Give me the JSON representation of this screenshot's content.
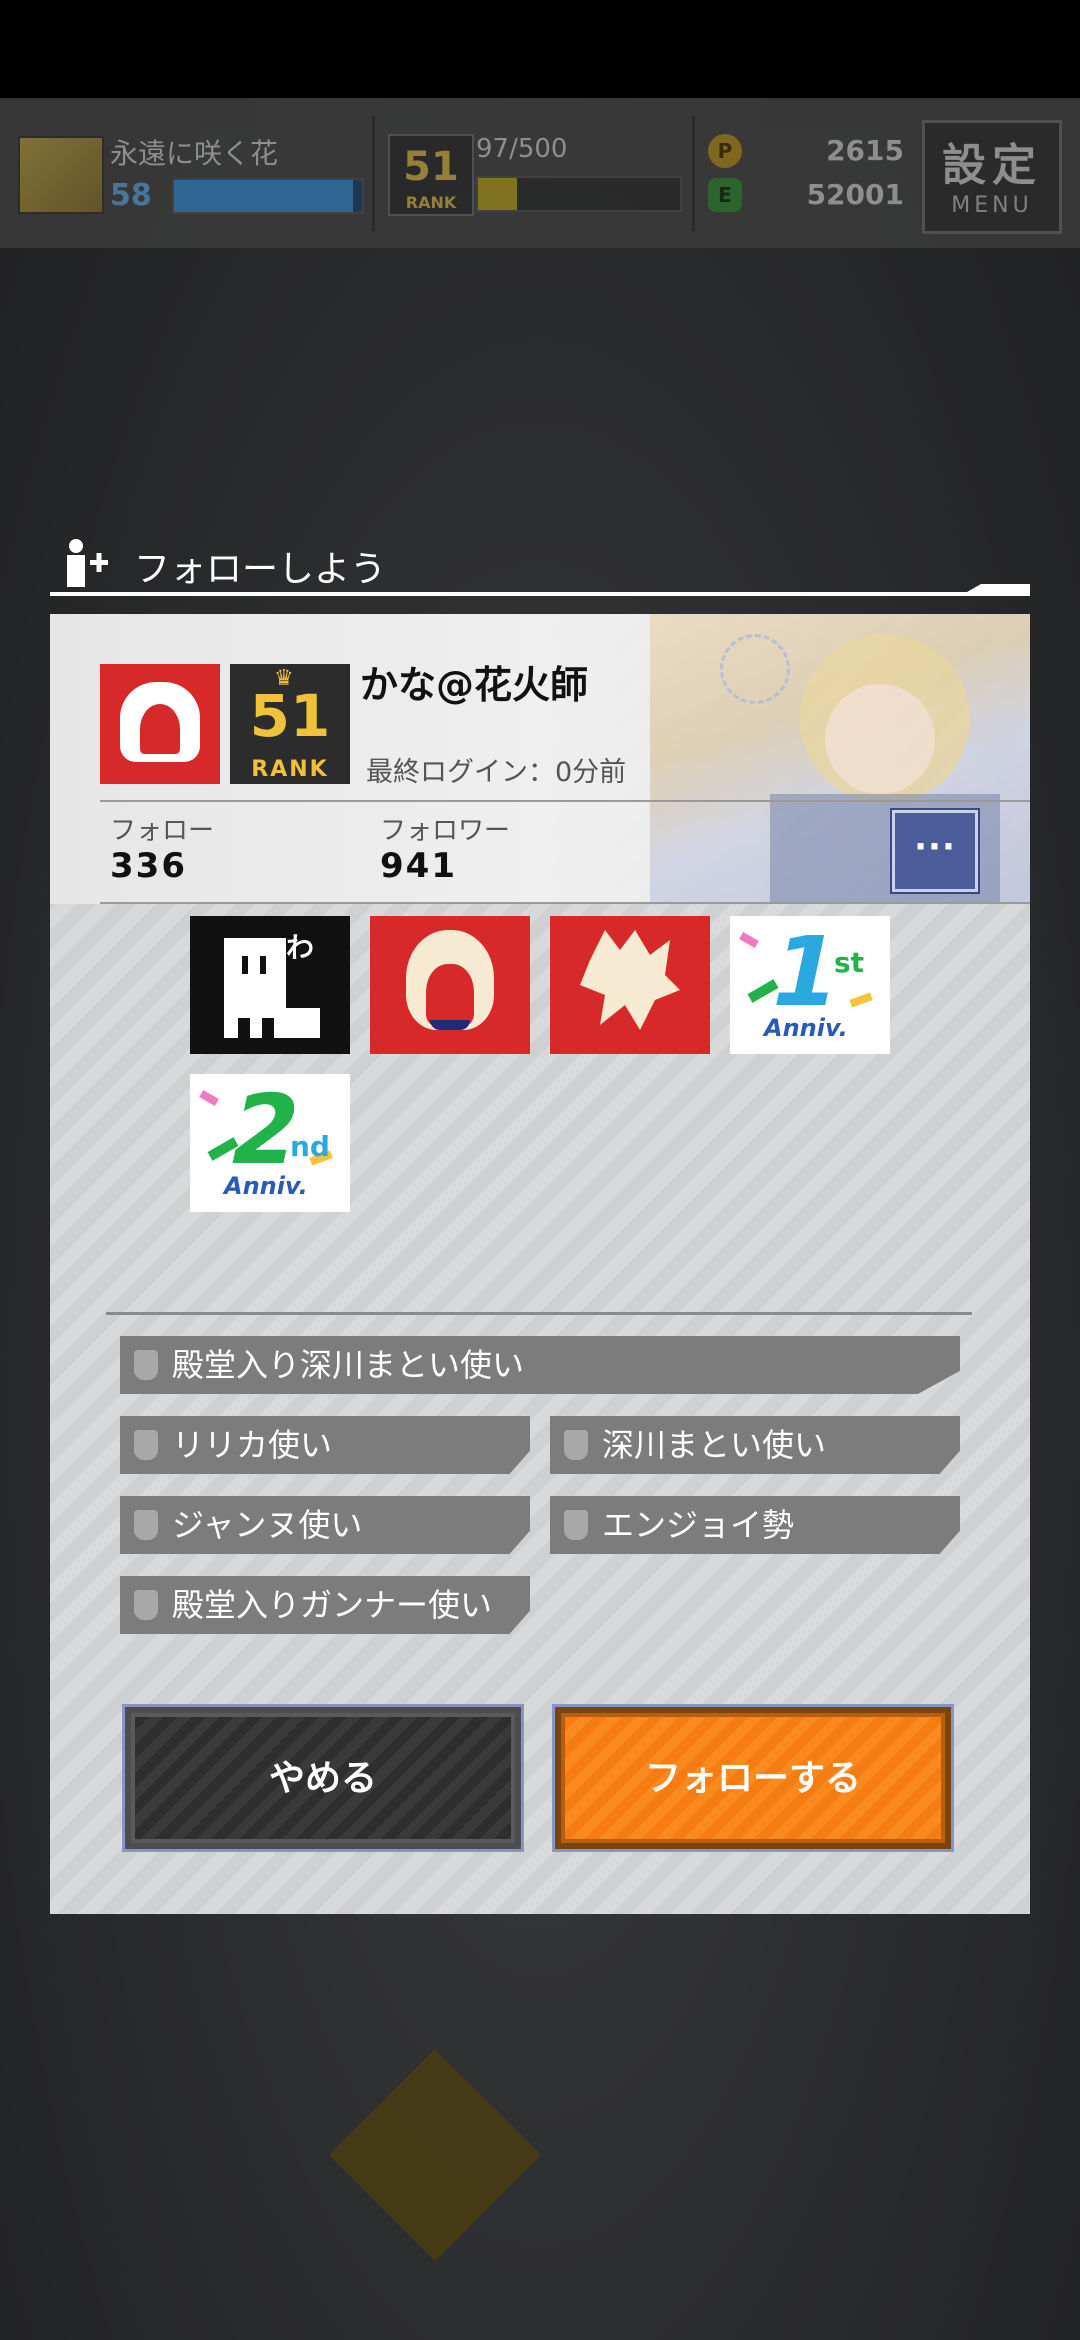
{
  "hud": {
    "player_name": "永遠に咲く花",
    "level": "58",
    "level_progress": 0.95,
    "rank_number": "51",
    "rank_label": "RANK",
    "stamina": "97/500",
    "stamina_progress": 0.194,
    "coins_gold": "2615",
    "coins_green": "52001",
    "menu_kanji": "設定",
    "menu_label": "MENU"
  },
  "dialog": {
    "title": "フォローしよう",
    "user": {
      "name": "かな@花火師",
      "last_login": "最終ログイン：0分前",
      "rank_number": "51",
      "rank_label": "RANK",
      "follow_label": "フォロー",
      "follow_count": "336",
      "follower_label": "フォロワー",
      "follower_count": "941",
      "more_label": "···"
    },
    "emblems": [
      {
        "name": "castle",
        "text": "わ"
      },
      {
        "name": "red-mask"
      },
      {
        "name": "red-burst"
      },
      {
        "name": "1st-anniv",
        "num": "1",
        "suffix": "st",
        "label": "Anniv."
      },
      {
        "name": "2nd-anniv",
        "num": "2",
        "suffix": "nd",
        "label": "Anniv."
      }
    ],
    "titles": [
      "殿堂入り深川まとい使い",
      "リリカ使い",
      "深川まとい使い",
      "ジャンヌ使い",
      "エンジョイ勢",
      "殿堂入りガンナー使い"
    ],
    "cancel_label": "やめる",
    "follow_label": "フォローする"
  },
  "colors": {
    "follow_button": "#f57c10",
    "more_button": "#4b5c9a",
    "rank_gold": "#f0c23a",
    "badge_red": "#d7282a"
  }
}
